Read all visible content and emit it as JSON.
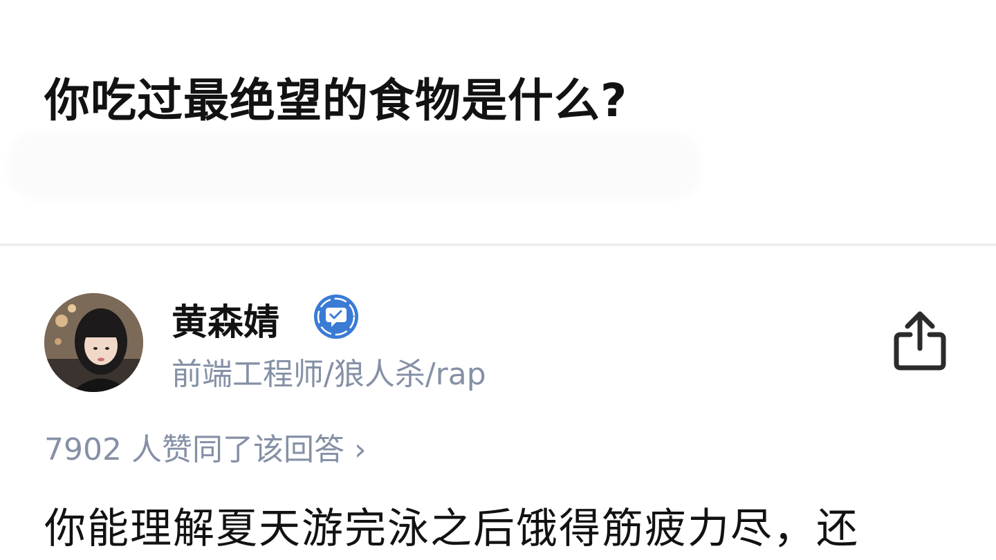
{
  "question": {
    "title": "你吃过最绝望的食物是什么?"
  },
  "answer": {
    "author": {
      "name": "黄森婧",
      "bio": "前端工程师/狼人杀/rap",
      "badge_icon": "verified-badge-icon",
      "avatar_icon": "avatar"
    },
    "votes_text": "7902 人赞同了该回答",
    "votes_chevron": "›",
    "content_first_line": "你能理解夏天游完泳之后饿得筋疲力尽，还",
    "share_icon": "share-icon"
  },
  "colors": {
    "title": "#121212",
    "secondary_text": "#8590a6",
    "badge_blue": "#3a7bd5",
    "divider": "#eeeeee"
  }
}
